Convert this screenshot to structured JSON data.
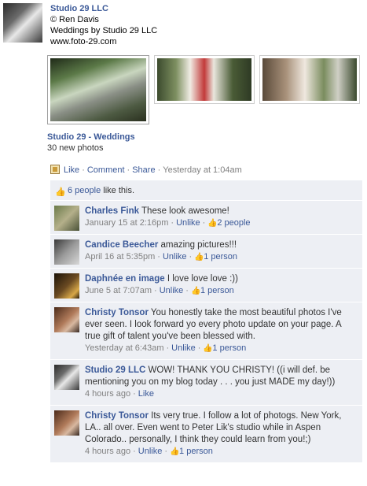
{
  "post": {
    "author": "Studio 29 LLC",
    "lines": [
      "© Ren Davis",
      "Weddings by Studio 29 LLC"
    ],
    "url": "www.foto-29.com",
    "album_title": "Studio 29 - Weddings",
    "album_count": "30 new photos"
  },
  "actions": {
    "like": "Like",
    "comment": "Comment",
    "share": "Share",
    "separator": "·",
    "timestamp": "Yesterday at 1:04am"
  },
  "likes": {
    "count_text": "6 people",
    "suffix": " like this."
  },
  "comments": [
    {
      "name": "Charles Fink",
      "text": " These look awesome!",
      "time": "January 15 at 2:16pm",
      "action": "Unlike",
      "likes": "2 people"
    },
    {
      "name": "Candice Beecher",
      "text": " amazing pictures!!!",
      "time": "April 16 at 5:35pm",
      "action": "Unlike",
      "likes": "1 person"
    },
    {
      "name": "Daphnée en image",
      "text": " I love love love :))",
      "time": "June 5 at 7:07am",
      "action": "Unlike",
      "likes": "1 person"
    },
    {
      "name": "Christy Tonsor",
      "text": " You honestly take the most beautiful photos I've ever seen. I look forward yo every photo update on your page. A true gift of talent you've been blessed with.",
      "time": "Yesterday at 6:43am",
      "action": "Unlike",
      "likes": "1 person"
    },
    {
      "name": "Studio 29 LLC",
      "text": " WOW! THANK YOU CHRISTY! ((i will def. be mentioning you on my blog today . . . you just MADE my day!))",
      "time": "4 hours ago",
      "action": "Like",
      "likes": ""
    },
    {
      "name": "Christy Tonsor",
      "text": " Its very true. I follow a lot of photogs. New York, LA.. all over. Even went to Peter Lik's studio while in Aspen Colorado.. personally, I think they could learn from you!;)",
      "time": "4 hours ago",
      "action": "Unlike",
      "likes": "1 person"
    }
  ],
  "icons": {
    "thumb": "thumbs-up-icon",
    "album": "photo-album-icon"
  },
  "colors": {
    "link": "#3b5998",
    "meta": "#808080",
    "ufi_bg": "#edeff4"
  }
}
